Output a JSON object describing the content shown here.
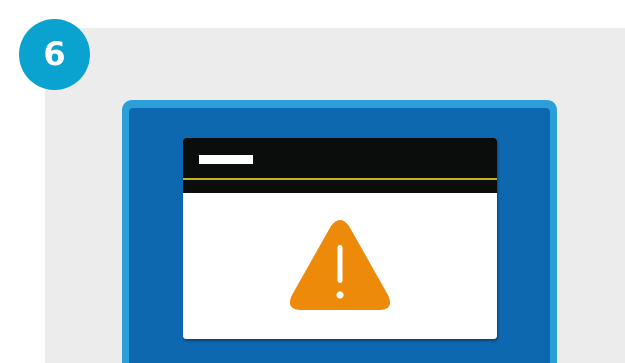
{
  "step": {
    "number": "6"
  },
  "colors": {
    "background_panel": "#ebeceb",
    "badge": "#0aa3cf",
    "monitor_bezel": "#2c9fd8",
    "monitor_screen": "#0e68b0",
    "dialog_titlebar": "#0b0d0c",
    "dialog_accent_line": "#c5b31c",
    "warning": "#ee8a0a"
  },
  "icons": {
    "warning": "warning-triangle-icon"
  }
}
